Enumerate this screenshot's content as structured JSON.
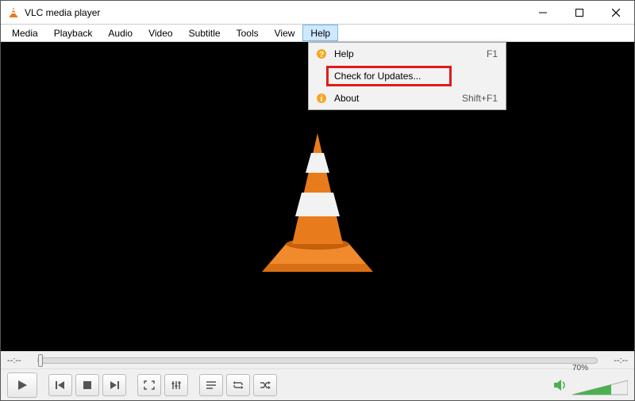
{
  "title": "VLC media player",
  "menubar": [
    "Media",
    "Playback",
    "Audio",
    "Video",
    "Subtitle",
    "Tools",
    "View",
    "Help"
  ],
  "activeMenu": "Help",
  "dropdown": {
    "items": [
      {
        "label": "Help",
        "shortcut": "F1",
        "icon": "question"
      },
      {
        "label": "Check for Updates...",
        "shortcut": "",
        "icon": ""
      },
      {
        "label": "About",
        "shortcut": "Shift+F1",
        "icon": "info"
      }
    ],
    "highlightIndex": 1
  },
  "seek": {
    "left": "--:--",
    "right": "--:--"
  },
  "volume": {
    "percent": "70%"
  }
}
